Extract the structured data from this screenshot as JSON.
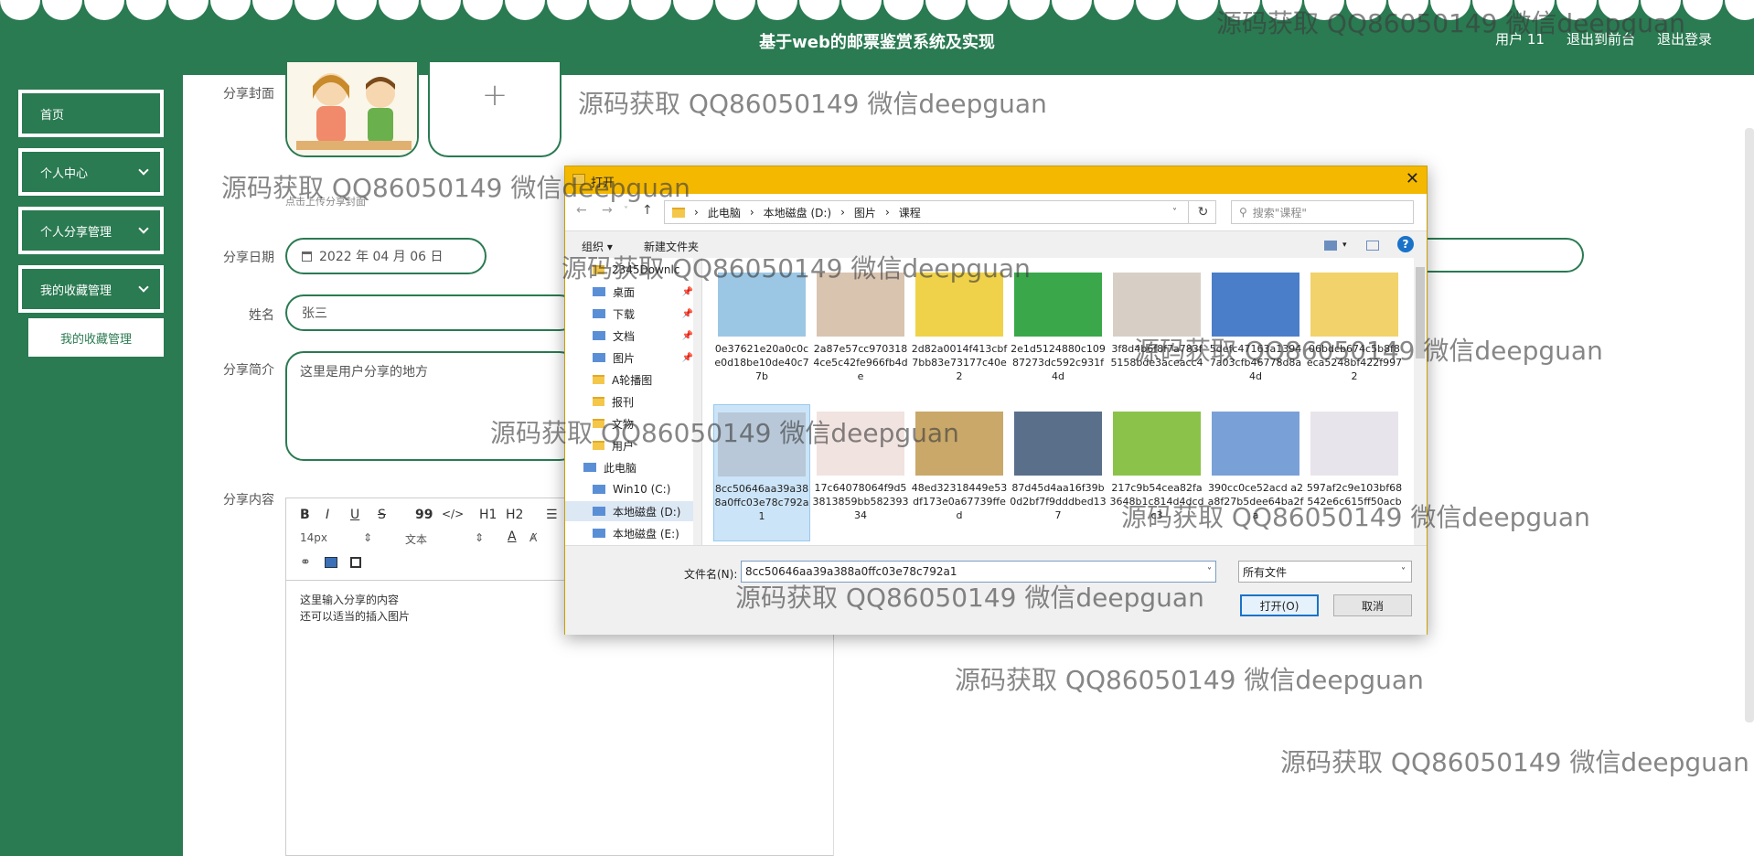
{
  "header": {
    "title": "基于web的邮票鉴赏系统及实现",
    "links": [
      "用户 11",
      "退出到前台",
      "退出登录"
    ]
  },
  "sidebar": {
    "items": [
      {
        "label": "首页"
      },
      {
        "label": "个人中心"
      },
      {
        "label": "个人分享管理"
      },
      {
        "label": "我的收藏管理"
      }
    ],
    "sub_item": "我的收藏管理"
  },
  "form": {
    "cover_label": "分享封面",
    "cover_plus": "+",
    "cover_hint": "点击上传分享封面",
    "date_label": "分享日期",
    "date_value": "2022 年 04 月 06 日",
    "name_label": "姓名",
    "name_value": "张三",
    "intro_label": "分享简介",
    "intro_value": "这里是用户分享的地方",
    "content_label": "分享内容",
    "toolbar": {
      "bold": "B",
      "italic": "I",
      "underline": "U",
      "strike": "S",
      "quote": "99",
      "code": "</>",
      "h1": "H1",
      "h2": "H2",
      "size": "14px",
      "font": "文本",
      "color": "A"
    },
    "content_lines": [
      "这里输入分享的内容",
      "还可以适当的插入图片"
    ]
  },
  "dialog": {
    "title": "打开",
    "path": [
      "此电脑",
      "本地磁盘 (D:)",
      "图片",
      "课程"
    ],
    "search_placeholder": "搜索\"课程\"",
    "organize": "组织 ▾",
    "new_folder": "新建文件夹",
    "help": "?",
    "tree": [
      {
        "label": "2345Downlc",
        "type": "folder"
      },
      {
        "label": "桌面",
        "type": "drive",
        "pin": true
      },
      {
        "label": "下载",
        "type": "drive",
        "pin": true
      },
      {
        "label": "文档",
        "type": "drive",
        "pin": true
      },
      {
        "label": "图片",
        "type": "drive",
        "pin": true
      },
      {
        "label": "A轮播图",
        "type": "folder"
      },
      {
        "label": "报刊",
        "type": "folder"
      },
      {
        "label": "文物",
        "type": "folder"
      },
      {
        "label": "用户",
        "type": "folder"
      },
      {
        "label": "此电脑",
        "type": "pc"
      },
      {
        "label": "Win10 (C:)",
        "type": "drive"
      },
      {
        "label": "本地磁盘 (D:)",
        "type": "drive",
        "selected": true
      },
      {
        "label": "本地磁盘 (E:)",
        "type": "drive"
      }
    ],
    "files": [
      {
        "name": "0e37621e20a0c0ce0d18be10de40c77b",
        "color": "#9cc7e4",
        "selected": false
      },
      {
        "name": "2a87e57cc9703184ce5c42fe966fb4de",
        "color": "#d9c4b0",
        "selected": false
      },
      {
        "name": "2d82a0014f413cbf7bb83e73177c40e2",
        "color": "#f0d24a",
        "selected": false
      },
      {
        "name": "2e1d5124880c10987273dc592c931f4d",
        "color": "#3aa84a",
        "selected": false
      },
      {
        "name": "3f8d4b6f8f7a783f5158bde3aceacc4",
        "color": "#d7cfc6",
        "selected": false
      },
      {
        "name": "5defc47163a13947a03cfb46778d8a4d",
        "color": "#4a7ec8",
        "selected": false
      },
      {
        "name": "06bdcb674c5b8f8eca5248bf422f9972",
        "color": "#f2d26a",
        "selected": false
      },
      {
        "name": "8cc50646aa39a388a0ffc03e78c792a1",
        "color": "#b8c8d8",
        "selected": true
      },
      {
        "name": "17c64078064f9d53813859bb58239334",
        "color": "#f1e3e0",
        "selected": false
      },
      {
        "name": "48ed32318449e53df173e0a67739ffed",
        "color": "#c9a86a",
        "selected": false
      },
      {
        "name": "87d45d4aa16f39b0d2bf7f9dddbed137",
        "color": "#5a6f8a",
        "selected": false
      },
      {
        "name": "217c9b54cea82fa3648b1c814d4dcdc3",
        "color": "#8bc34a",
        "selected": false
      },
      {
        "name": "390cc0ce52acd a2a8f27b5dee64ba2fa",
        "color": "#7aa0d8",
        "selected": false
      },
      {
        "name": "597af2c9e103bf68542e6c615ff50acb",
        "color": "#e8e4ec",
        "selected": false
      }
    ],
    "filename_label": "文件名(N):",
    "filename_value": "8cc50646aa39a388a0ffc03e78c792a1",
    "filetype": "所有文件",
    "open_button": "打开(O)",
    "cancel_button": "取消"
  },
  "watermark": "源码获取 QQ86050149 微信deepguan",
  "colors": {
    "accent": "#2a7a52",
    "dialog_title": "#f5b800"
  }
}
